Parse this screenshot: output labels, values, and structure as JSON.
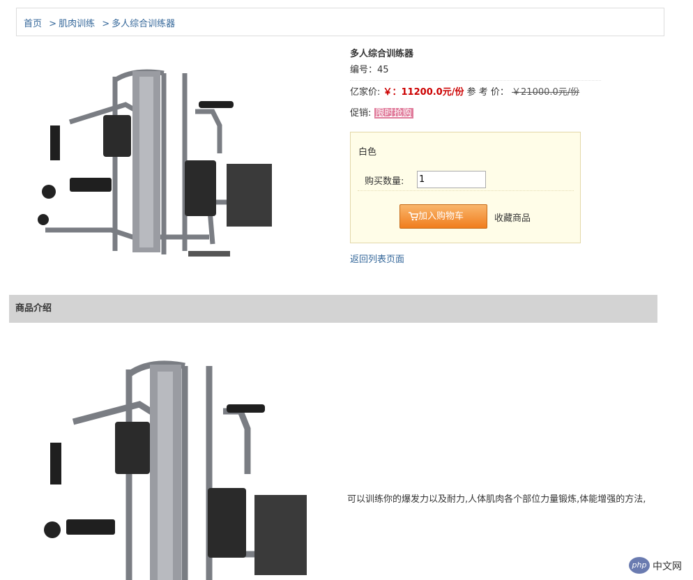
{
  "breadcrumb": {
    "home": "首页",
    "cat": "肌肉训练",
    "current": "多人综合训练器",
    "sep": ">"
  },
  "product": {
    "name": "多人综合训练器",
    "code_label": "编号：",
    "code": "45",
    "price_label": "亿家价: ",
    "price": "￥：11200.0元/份",
    "ref_label": " 参 考 价：",
    "ref_price": "￥21000.0元/份",
    "promo_label": "促销: ",
    "promo": "限时抢购",
    "color": "白色",
    "qty_label": "购买数量:",
    "qty_value": "1",
    "cart_button": "加入购物车",
    "fav": "收藏商品",
    "back": "返回列表页面"
  },
  "section": {
    "title": "商品介绍"
  },
  "description": "可以训练你的爆发力以及耐力,人体肌肉各个部位力量锻炼,体能增强的方法,",
  "watermark": {
    "logo": "php",
    "text": "中文网"
  },
  "colors": {
    "link": "#336699",
    "price": "#cc0000",
    "button": "#f07d1d",
    "bar": "#d3d3d3"
  }
}
